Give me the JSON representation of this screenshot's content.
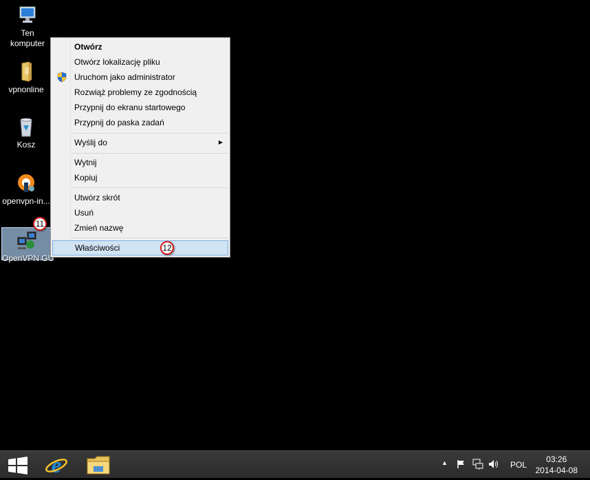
{
  "desktop": {
    "icons": [
      {
        "label_line1": "Ten",
        "label_line2": "komputer",
        "icon": "computer-icon"
      },
      {
        "label": "vpnonline",
        "icon": "folder-icon"
      },
      {
        "label": "Kosz",
        "icon": "recycle-bin-icon"
      },
      {
        "label": "openvpn-in...",
        "icon": "openvpn-installer-icon"
      },
      {
        "label": "OpenVPN GUI",
        "icon": "openvpn-gui-icon",
        "selected": true
      }
    ]
  },
  "context_menu": {
    "items": [
      {
        "label": "Otwórz",
        "bold": true
      },
      {
        "label": "Otwórz lokalizację pliku"
      },
      {
        "label": "Uruchom jako administrator",
        "icon": "uac-shield-icon"
      },
      {
        "label": "Rozwiąż problemy ze zgodnością"
      },
      {
        "label": "Przypnij do ekranu startowego"
      },
      {
        "label": "Przypnij do paska zadań"
      },
      {
        "label": "Wyślij do",
        "submenu": true
      },
      {
        "label": "Wytnij"
      },
      {
        "label": "Kopiuj"
      },
      {
        "label": "Utwórz skrót"
      },
      {
        "label": "Usuń"
      },
      {
        "label": "Zmień nazwę"
      },
      {
        "label": "Właściwości",
        "highlighted": true
      }
    ]
  },
  "annotations": {
    "badge_11": "11",
    "badge_12": "12"
  },
  "taskbar": {
    "pinned": [
      "windows-start-icon",
      "internet-explorer-icon",
      "file-explorer-icon"
    ],
    "tray": {
      "language": "POL",
      "time": "03:26",
      "date": "2014-04-08",
      "icons": [
        "show-hidden-icons-chevron",
        "action-center-flag-icon",
        "network-icon",
        "volume-icon"
      ]
    }
  },
  "colors": {
    "badge_border": "#d21e1e",
    "menu_highlight": "#d1e2f2",
    "selection": "#9ebcde"
  }
}
